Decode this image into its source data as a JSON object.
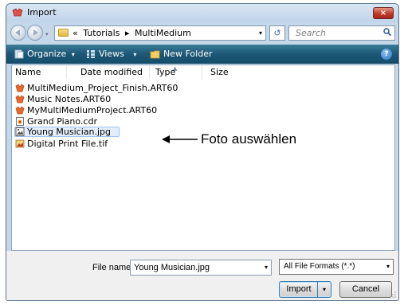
{
  "window": {
    "title": "Import",
    "close_glyph": "×",
    "close_icon": "close-icon"
  },
  "address": {
    "crumbs": [
      "«",
      "Tutorials",
      "▸",
      "MultiMedium"
    ],
    "dropdown_glyph": "▾",
    "refresh_glyph": "↺",
    "search_placeholder": "Search"
  },
  "toolbar": {
    "organize_label": "Organize",
    "views_label": "Views",
    "new_folder_label": "New Folder",
    "drop_glyph": "▾",
    "help_glyph": "?"
  },
  "columns": [
    "Name",
    "Date modified",
    "Type",
    "Size"
  ],
  "files": [
    {
      "name": "MultiMedium_Project_Finish.ART60",
      "icon": "art60-icon"
    },
    {
      "name": "Music Notes.ART60",
      "icon": "art60-icon"
    },
    {
      "name": "MyMultiMediumProject.ART60",
      "icon": "art60-icon"
    },
    {
      "name": "Grand Piano.cdr",
      "icon": "cdr-icon"
    },
    {
      "name": "Young Musician.jpg",
      "icon": "jpg-icon",
      "selected": true
    },
    {
      "name": "Digital Print File.tif",
      "icon": "tif-icon"
    }
  ],
  "annotation": {
    "text": "Foto auswählen"
  },
  "bottom": {
    "file_name_label": "File name:",
    "file_name_value": "Young Musician.jpg",
    "file_type_value": "All File Formats (*.*)",
    "import_label": "Import",
    "cancel_label": "Cancel",
    "drop_glyph": "▾"
  },
  "colors": {
    "toolbar": "#1c5775",
    "selection": "#e4eefa",
    "close": "#c2392a",
    "accent": "#3c7fb1"
  }
}
